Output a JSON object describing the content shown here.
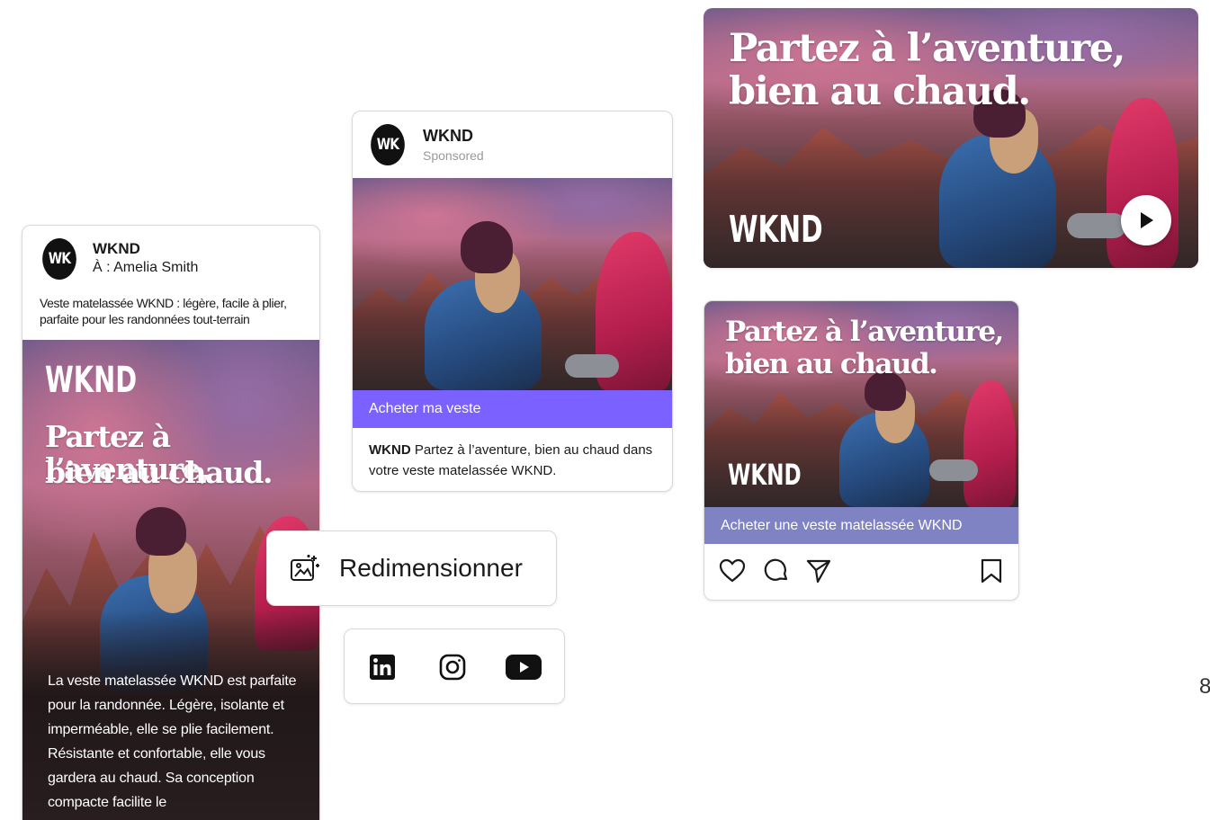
{
  "brand": {
    "avatar_text": "WK",
    "name": "WKND",
    "logo": "WKND",
    "accent_color": "#7b61ff",
    "cta_lavender": "#7f83c4"
  },
  "email_card": {
    "recipient": "À : Amelia Smith",
    "preheader": "Veste matelassée WKND : légère, facile à plier, parfaite pour les randonnées tout-terrain",
    "headline_line1": "Partez à l’aventure,",
    "headline_line2": "bien au chaud.",
    "body": "La  veste matelassée WKND est parfaite pour la randonnée. Légère, isolante et imperméable, elle se plie facilement. Résistante et confortable, elle vous gardera au chaud. Sa conception compacte facilite le"
  },
  "sponsored_card": {
    "label": "Sponsored",
    "cta": "Acheter ma veste",
    "caption_brand": "WKND",
    "caption_text": "Partez à l’aventure, bien au chaud dans votre veste matelassée WKND."
  },
  "video_card": {
    "headline_line1": "Partez à l’aventure,",
    "headline_line2": "bien au chaud.",
    "play_icon": "play-icon"
  },
  "instagram_card": {
    "headline_line1": "Partez à l’aventure,",
    "headline_line2": "bien au chaud.",
    "cta": "Acheter une veste matelassée WKND",
    "icons": [
      "heart-icon",
      "comment-icon",
      "share-icon",
      "bookmark-icon"
    ]
  },
  "resize_button": {
    "label": "Redimensionner",
    "icon": "resize-icon"
  },
  "social_icons": [
    "linkedin-icon",
    "instagram-icon",
    "youtube-icon"
  ],
  "edge_text": "8"
}
